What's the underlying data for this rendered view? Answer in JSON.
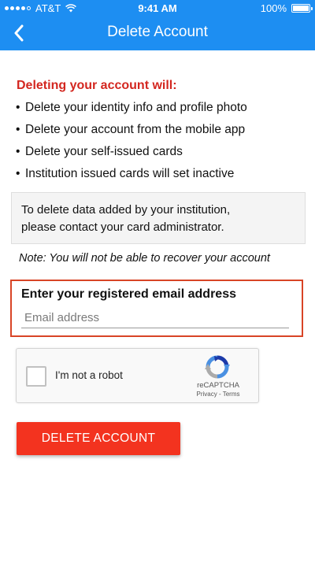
{
  "status_bar": {
    "carrier": "AT&T",
    "time": "9:41 AM",
    "battery": "100%"
  },
  "header": {
    "title": "Delete Account",
    "color": "#1d8ef2"
  },
  "warning": {
    "title": "Deleting your account will:",
    "items": [
      "Delete your identity info and profile photo",
      "Delete your account from the mobile app",
      "Delete your self-issued cards",
      "Institution issued cards will set inactive"
    ]
  },
  "info_box": {
    "line1": "To delete data added by your institution,",
    "line2": "please contact your card administrator."
  },
  "note": "Note: You will not be able to recover your account",
  "email": {
    "label": "Enter your registered email address",
    "value": "",
    "placeholder": "Email address"
  },
  "recaptcha": {
    "label": "I'm not a robot",
    "brand": "reCAPTCHA",
    "privacy": "Privacy",
    "separator": "-",
    "terms": "Terms",
    "checked": false
  },
  "delete_button": {
    "label": "DELETE ACCOUNT",
    "color": "#f3331f"
  },
  "icons": [
    "signal-icon",
    "wifi-icon",
    "battery-icon",
    "back-arrow-icon",
    "recaptcha-logo-icon"
  ]
}
